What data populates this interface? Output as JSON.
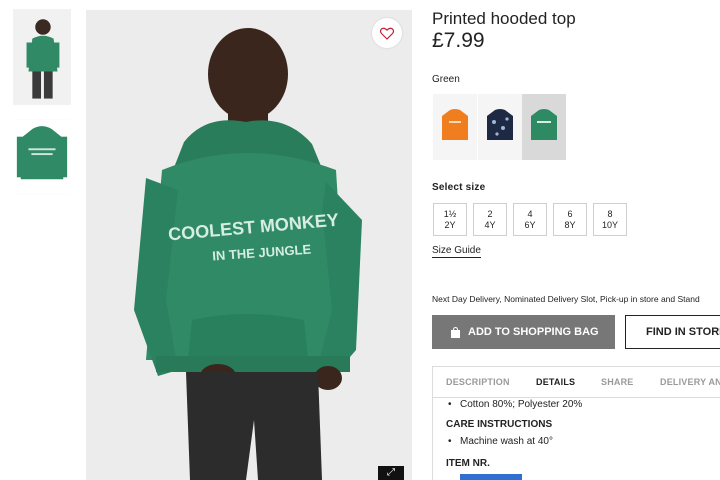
{
  "product": {
    "title": "Printed hooded top",
    "price": "£7.99",
    "color_label": "Green",
    "hoodie_print_line1": "COOLEST MONKEY",
    "hoodie_print_line2": "IN THE JUNGLE"
  },
  "colors": {
    "swatches": [
      {
        "name": "orange-hoodie",
        "hex": "#f07d1e"
      },
      {
        "name": "navy-print-hoodie",
        "hex": "#1e2a44"
      },
      {
        "name": "green-hoodie",
        "hex": "#2e8a63",
        "selected": true
      }
    ],
    "hoodie_green": "#2f8a65",
    "button_grey": "#777777"
  },
  "sizes": {
    "label": "Select size",
    "options": [
      {
        "top": "1½",
        "bottom": "2Y"
      },
      {
        "top": "2",
        "bottom": "4Y"
      },
      {
        "top": "4",
        "bottom": "6Y"
      },
      {
        "top": "6",
        "bottom": "8Y"
      },
      {
        "top": "8",
        "bottom": "10Y"
      }
    ],
    "guide": "Size Guide"
  },
  "delivery_text": "Next Day Delivery, Nominated Delivery Slot, Pick-up in store and Stand",
  "actions": {
    "add_to_bag": "ADD TO SHOPPING BAG",
    "find_in_store": "FIND IN STORE"
  },
  "tabs": [
    "DESCRIPTION",
    "DETAILS",
    "SHARE",
    "DELIVERY AN"
  ],
  "details": {
    "composition": "Cotton 80%; Polyester 20%",
    "care_heading": "CARE INSTRUCTIONS",
    "care_item": "Machine wash at 40°",
    "item_heading": "ITEM NR."
  },
  "icons": {
    "wishlist": "heart-icon",
    "bag": "shopping-bag-icon",
    "zoom": "zoom-icon"
  }
}
